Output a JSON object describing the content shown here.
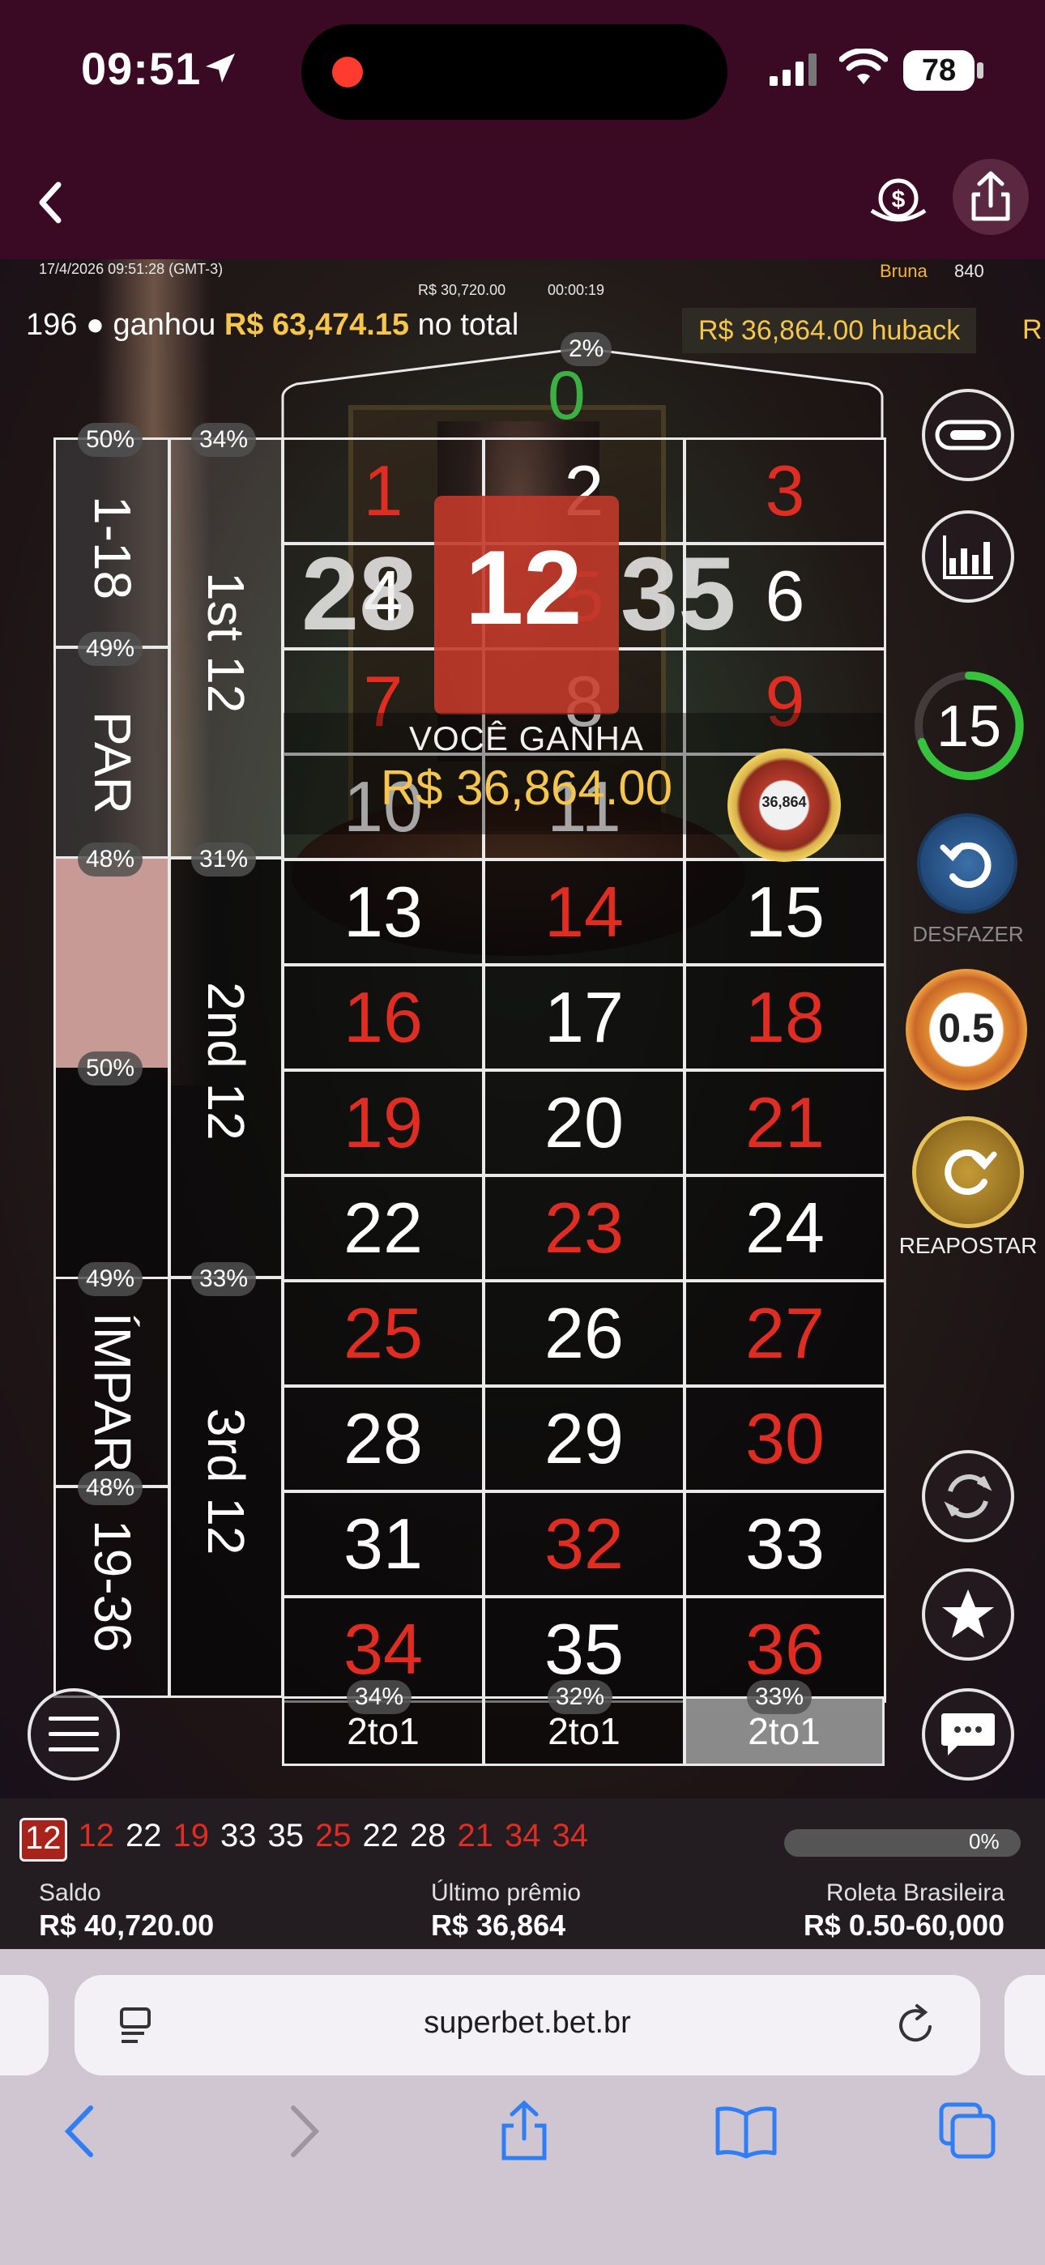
{
  "status_bar": {
    "time": "09:51",
    "battery": "78"
  },
  "nav": {
    "back": "back",
    "icons": [
      "coin-refresh-icon",
      "share-icon"
    ]
  },
  "game_info": {
    "timestamp": "17/4/2026 09:51:28 (GMT-3)",
    "balance_small": "R$ 30,720.00",
    "elapsed": "00:00:19",
    "username": "Bruna",
    "user_count": "840"
  },
  "ticker": {
    "count": "196",
    "won": "ganhou",
    "amount": "R$ 63,474.15",
    "suffix": "no total",
    "right": "R$ 36,864.00 huback",
    "edge": "R"
  },
  "table": {
    "zero": "0",
    "zero_pct": "2%",
    "numbers": [
      [
        "1",
        "2",
        "3"
      ],
      [
        "4",
        "5",
        "6"
      ],
      [
        "7",
        "8",
        "9"
      ],
      [
        "10",
        "11",
        "12"
      ],
      [
        "13",
        "14",
        "15"
      ],
      [
        "16",
        "17",
        "18"
      ],
      [
        "19",
        "20",
        "21"
      ],
      [
        "22",
        "23",
        "24"
      ],
      [
        "25",
        "26",
        "27"
      ],
      [
        "28",
        "29",
        "30"
      ],
      [
        "31",
        "32",
        "33"
      ],
      [
        "34",
        "35",
        "36"
      ]
    ],
    "red_numbers": [
      "1",
      "3",
      "5",
      "7",
      "9",
      "12",
      "14",
      "16",
      "18",
      "19",
      "21",
      "23",
      "25",
      "27",
      "30",
      "32",
      "34",
      "36"
    ],
    "outside": {
      "low": "1-18",
      "even": "PAR",
      "odd": "ÍMPAR",
      "high": "19-36",
      "dozen1": "1st 12",
      "dozen2": "2nd 12",
      "dozen3": "3rd 12"
    },
    "pct_outside": [
      "50%",
      "49%",
      "48%",
      "50%",
      "49%",
      "48%"
    ],
    "pct_dozens": [
      "34%",
      "31%",
      "33%"
    ],
    "columns": {
      "label": "2to1",
      "pcts": [
        "34%",
        "32%",
        "33%"
      ]
    }
  },
  "result": {
    "prev": "28",
    "current": "12",
    "next": "35",
    "win_label": "VOCÊ GANHA",
    "win_amount": "R$ 36,864.00",
    "chip_amount": "36,864"
  },
  "controls": {
    "timer": "15",
    "undo_label": "DESFAZER",
    "chip_value": "0.5",
    "rebet_label": "REAPOSTAR"
  },
  "history": [
    "12",
    "12",
    "22",
    "19",
    "33",
    "35",
    "25",
    "22",
    "28",
    "21",
    "34",
    "34"
  ],
  "history_red": [
    "12",
    "19",
    "25",
    "21",
    "34"
  ],
  "progress": "0%",
  "footer": {
    "balance_label": "Saldo",
    "balance": "R$ 40,720.00",
    "last_prize_label": "Último prêmio",
    "last_prize": "R$ 36,864",
    "game_label": "Roleta Brasileira",
    "limits": "R$ 0.50-60,000"
  },
  "browser": {
    "url": "superbet.bet.br"
  },
  "colors": {
    "red": "#e12c22",
    "gold": "#f6c54b",
    "header": "#3a0a24",
    "timer_ring": "#36c23a"
  }
}
